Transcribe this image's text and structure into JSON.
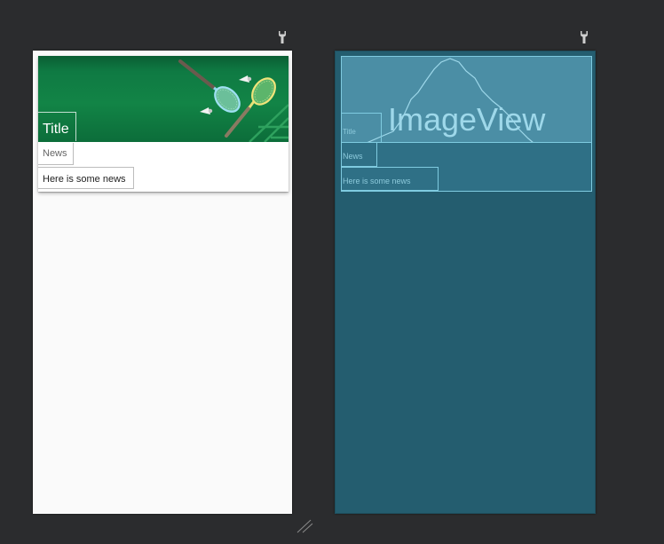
{
  "design": {
    "title": "Title",
    "news_label": "News",
    "news_body": "Here is some news"
  },
  "blueprint": {
    "image_label": "ImageView",
    "title": "Title",
    "news_label": "News",
    "news_body": "Here is some news"
  },
  "icons": {
    "design_settings": "wrench-icon",
    "blueprint_settings": "wrench-icon",
    "resize": "resize-handle-icon"
  },
  "colors": {
    "canvas_background": "#2b2c2e",
    "design_background": "#fafafa",
    "banner_green": "#128446",
    "blueprint_background": "#245d6f",
    "blueprint_outline": "#7fcbe0"
  }
}
